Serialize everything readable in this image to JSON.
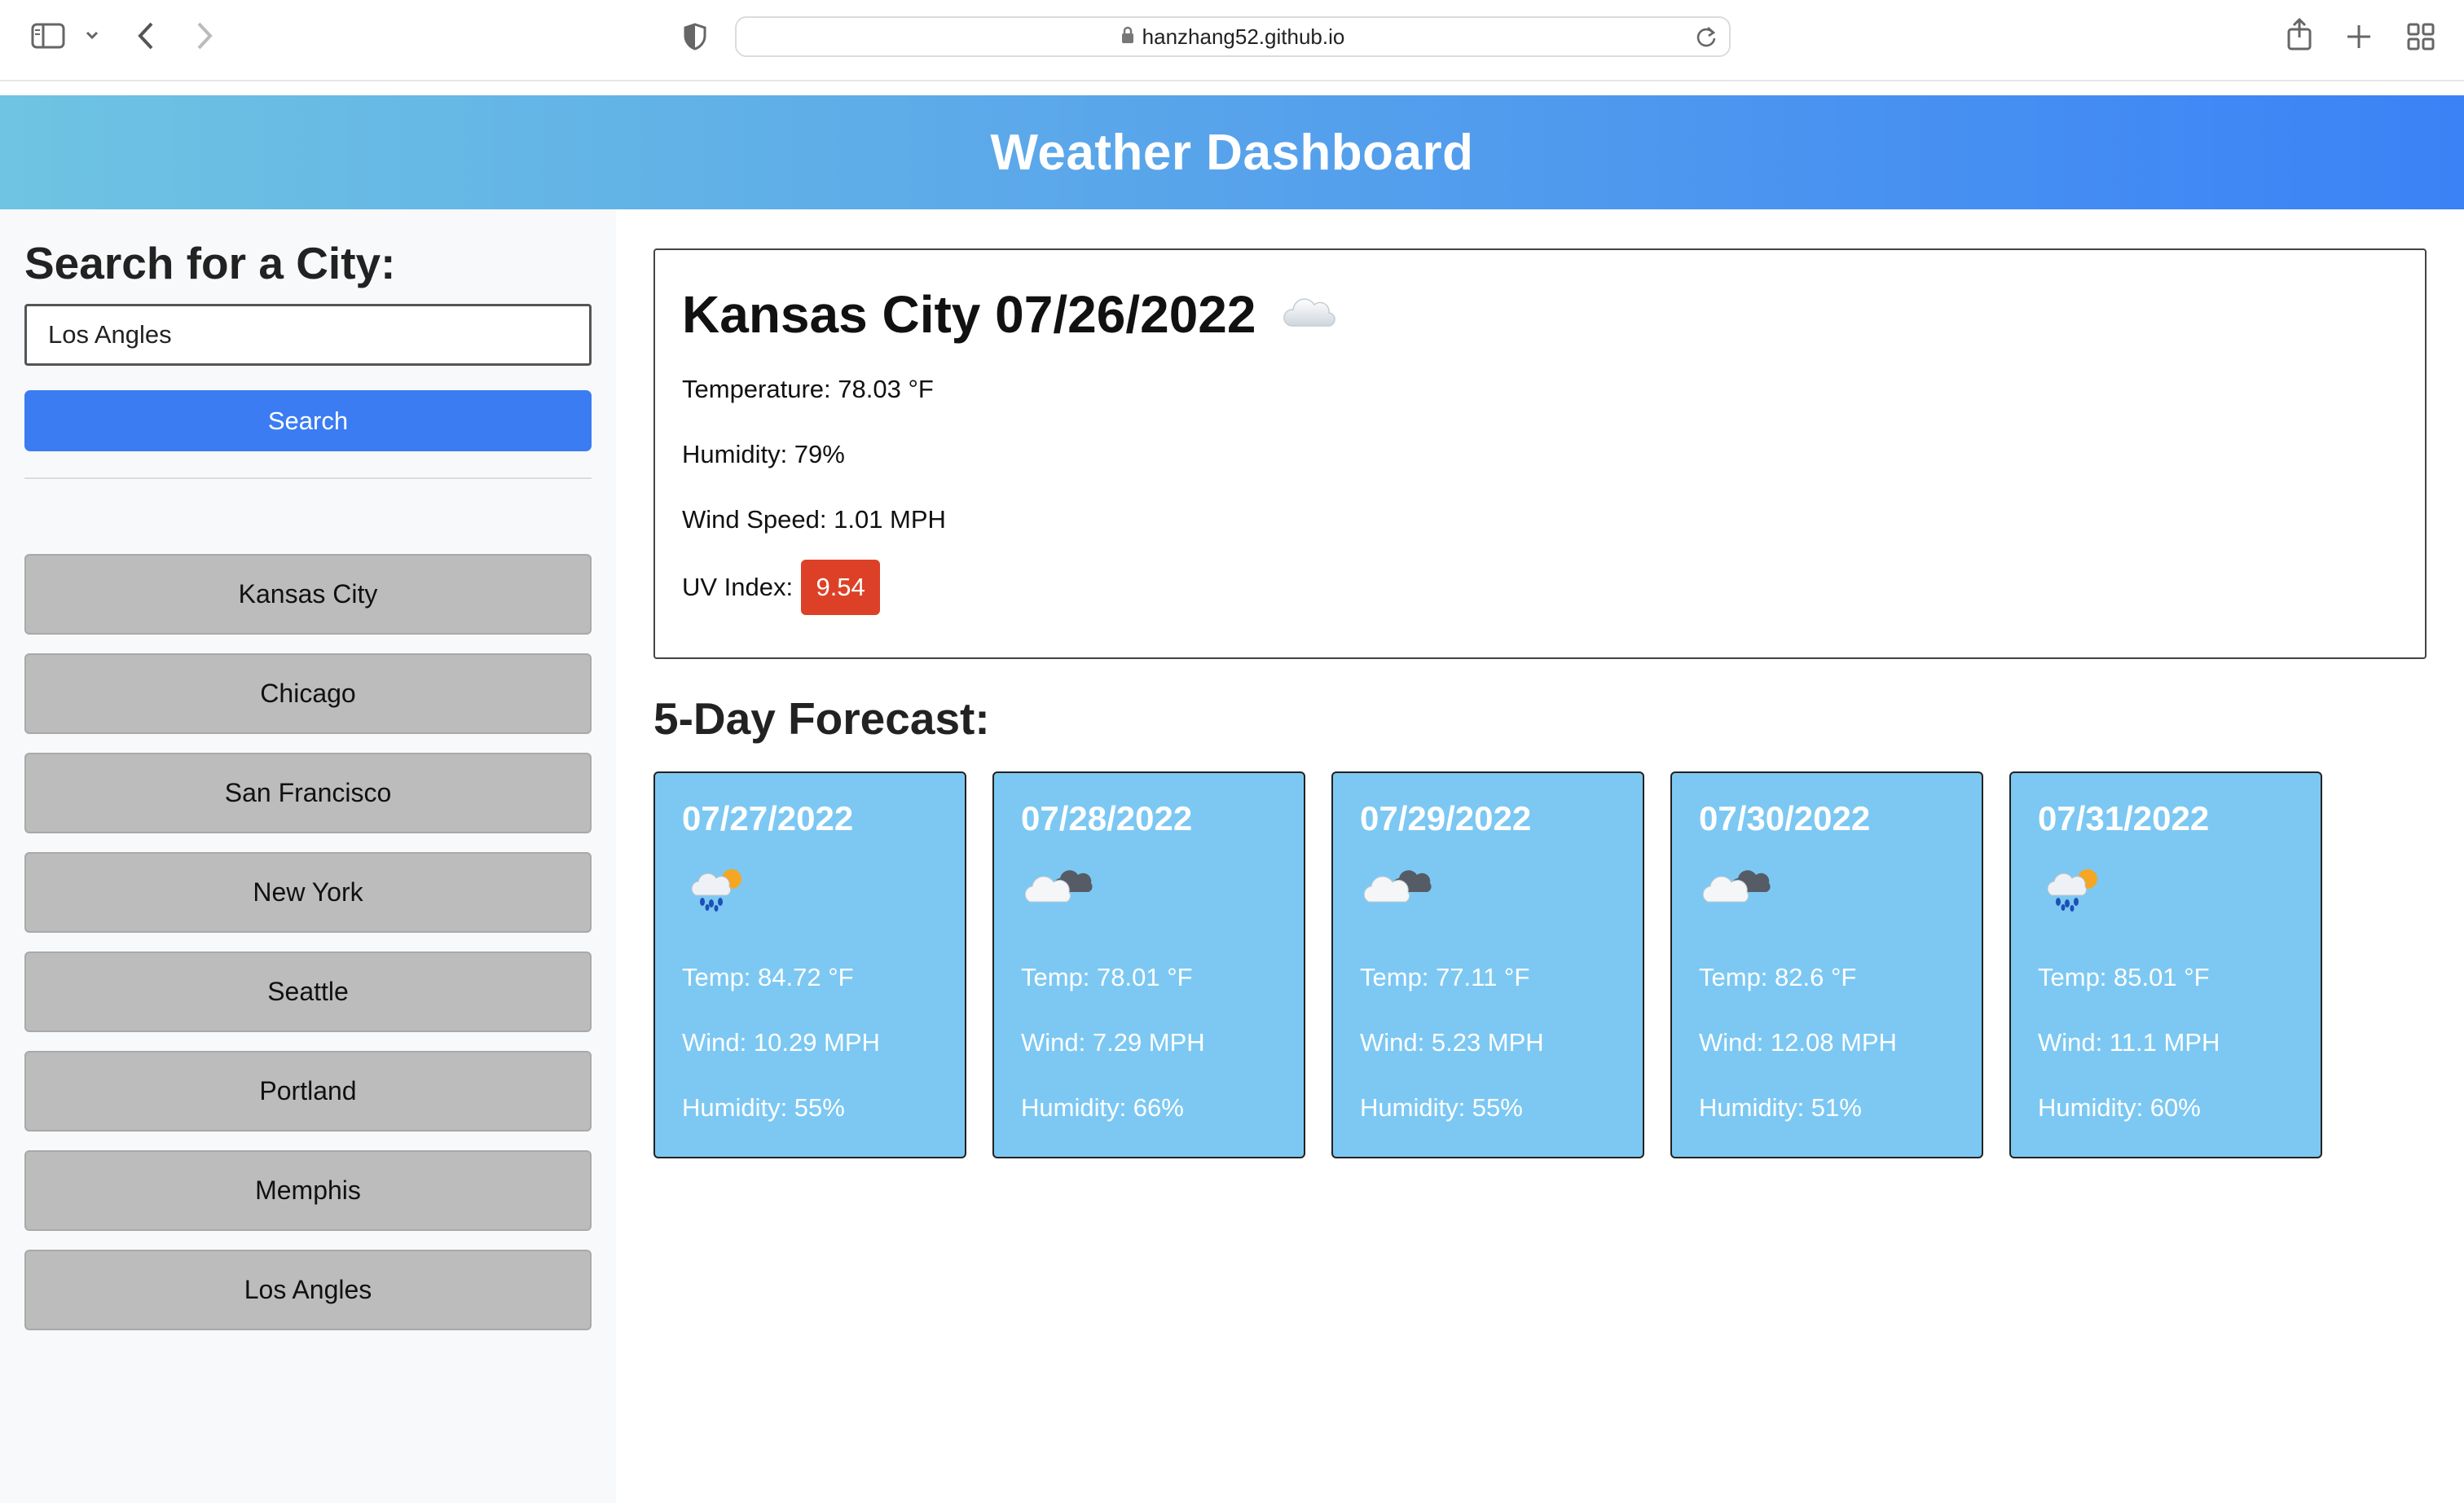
{
  "browser": {
    "url": "hanzhang52.github.io",
    "icons": [
      "sidebar-icon",
      "chevron-down-icon",
      "back-icon",
      "forward-icon",
      "shield-icon",
      "lock-icon",
      "reload-icon",
      "share-icon",
      "new-tab-icon",
      "tab-overview-icon"
    ]
  },
  "header": {
    "title": "Weather Dashboard"
  },
  "sidebar": {
    "title": "Search for a City:",
    "search_value": "Los Angles",
    "search_button": "Search",
    "history": [
      "Kansas City",
      "Chicago",
      "San Francisco",
      "New York",
      "Seattle",
      "Portland",
      "Memphis",
      "Los Angles"
    ]
  },
  "current": {
    "title": "Kansas City 07/26/2022",
    "icon": "cloud-icon",
    "temperature": "Temperature: 78.03 °F",
    "humidity": "Humidity: 79%",
    "wind": "Wind Speed: 1.01 MPH",
    "uv_label": "UV Index:",
    "uv_value": "9.54",
    "uv_color": "#dc4128"
  },
  "forecast": {
    "title": "5-Day Forecast:",
    "card_color": "#7cc8f3",
    "days": [
      {
        "date": "07/27/2022",
        "icon": "rain-sun-icon",
        "temp": "Temp: 84.72 °F",
        "wind": "Wind: 10.29 MPH",
        "humidity": "Humidity: 55%"
      },
      {
        "date": "07/28/2022",
        "icon": "broken-clouds-icon",
        "temp": "Temp: 78.01 °F",
        "wind": "Wind: 7.29 MPH",
        "humidity": "Humidity: 66%"
      },
      {
        "date": "07/29/2022",
        "icon": "broken-clouds-icon",
        "temp": "Temp: 77.11 °F",
        "wind": "Wind: 5.23 MPH",
        "humidity": "Humidity: 55%"
      },
      {
        "date": "07/30/2022",
        "icon": "broken-clouds-icon",
        "temp": "Temp: 82.6 °F",
        "wind": "Wind: 12.08 MPH",
        "humidity": "Humidity: 51%"
      },
      {
        "date": "07/31/2022",
        "icon": "rain-sun-icon",
        "temp": "Temp: 85.01 °F",
        "wind": "Wind: 11.1 MPH",
        "humidity": "Humidity: 60%"
      }
    ]
  }
}
